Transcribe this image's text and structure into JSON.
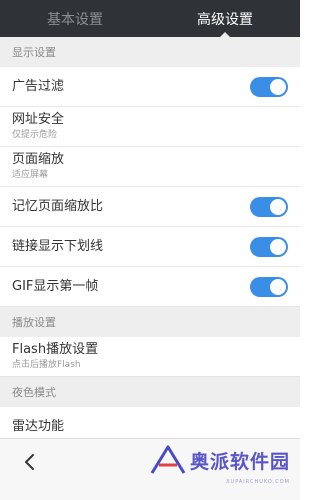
{
  "tabs": [
    {
      "label": "基本设置",
      "active": false
    },
    {
      "label": "高级设置",
      "active": true
    }
  ],
  "sections": {
    "display": "显示设置",
    "playback": "播放设置",
    "night": "夜色模式"
  },
  "settings": {
    "ad_filter": {
      "label": "广告过滤",
      "enabled": true
    },
    "url_security": {
      "label": "网址安全",
      "sub": "仅提示危险"
    },
    "page_zoom": {
      "label": "页面缩放",
      "sub": "适应屏幕"
    },
    "remember_zoom": {
      "label": "记忆页面缩放比",
      "enabled": true
    },
    "link_underline": {
      "label": "链接显示下划线",
      "enabled": true
    },
    "gif_first_frame": {
      "label": "GIF显示第一帧",
      "enabled": true
    },
    "flash": {
      "label": "Flash播放设置",
      "sub": "点击后播放Flash"
    },
    "radar": {
      "label": "雷达功能"
    }
  },
  "watermark": {
    "text": "奥派软件园",
    "url": "XUPAIRCHUKO.COM"
  },
  "colors": {
    "toggle_on": "#3a8ee6",
    "tabbar": "#2f3237",
    "section_bg": "#eeeeee"
  }
}
